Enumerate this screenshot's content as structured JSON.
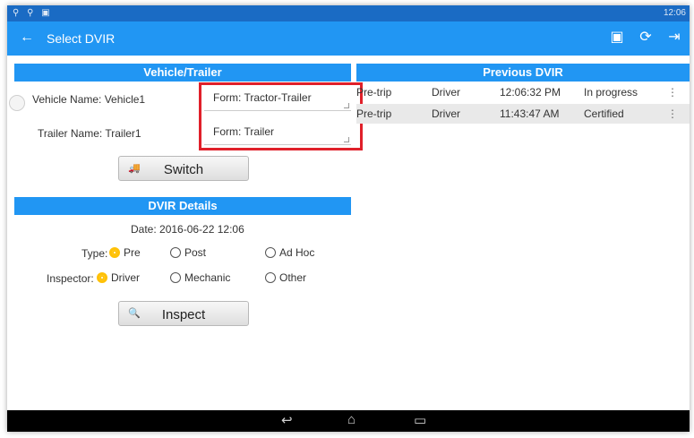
{
  "statusbar": {
    "left_icons": "⚲ ⚲ ▣",
    "time": "12:06"
  },
  "appbar": {
    "title": "Select DVIR",
    "back_glyph": "←",
    "actions": [
      {
        "icon": "dvir-icon",
        "glyph": "▣"
      },
      {
        "icon": "refresh-icon",
        "glyph": "⟳"
      },
      {
        "icon": "logout-icon",
        "glyph": "⇥"
      }
    ]
  },
  "vehicle": {
    "header": "Vehicle/Trailer",
    "vehicle_name": "Vehicle Name: Vehicle1",
    "vehicle_form": "Form:  Tractor-Trailer",
    "trailer_name": "Trailer Name: Trailer1",
    "trailer_form": "Form:  Trailer",
    "switch_label": "Switch",
    "switch_icon": "🚚"
  },
  "details": {
    "header": "DVIR Details",
    "date": "Date: 2016-06-22 12:06",
    "type_label": "Type:",
    "type_options": [
      "Pre",
      "Post",
      "Ad Hoc"
    ],
    "type_selected": "Pre",
    "inspector_label": "Inspector:",
    "inspector_options": [
      "Driver",
      "Mechanic",
      "Other"
    ],
    "inspector_selected": "Driver",
    "inspect_label": "Inspect",
    "inspect_icon": "🔍"
  },
  "previous": {
    "header": "Previous DVIR",
    "rows": [
      {
        "type": "Pre-trip",
        "inspector": "Driver",
        "time": "12:06:32 PM",
        "status": "In progress"
      },
      {
        "type": "Pre-trip",
        "inspector": "Driver",
        "time": "11:43:47 AM",
        "status": "Certified"
      }
    ]
  },
  "navbar": {
    "back": "↩",
    "home": "⌂",
    "recents": "▭"
  }
}
